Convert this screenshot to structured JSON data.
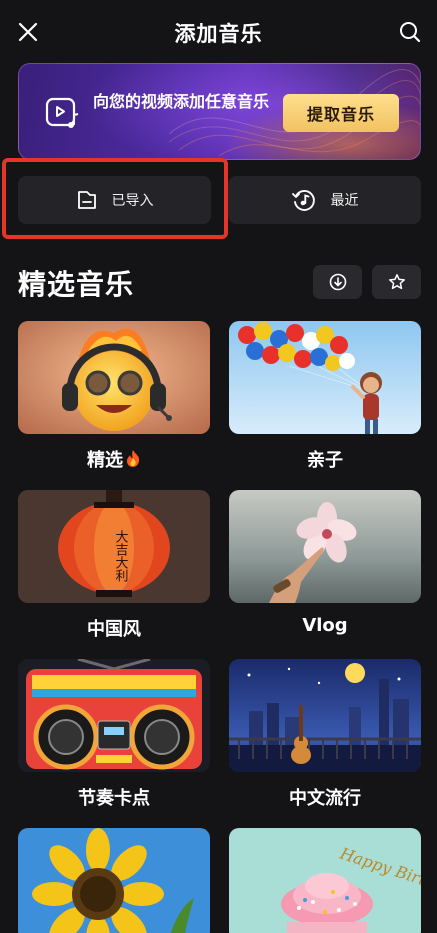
{
  "header": {
    "title": "添加音乐",
    "close_icon": "close-icon",
    "search_icon": "search-icon"
  },
  "banner": {
    "text": "向您的视频添加任意音乐",
    "button_label": "提取音乐",
    "icon": "video-music-icon",
    "button_color": "#f1c261"
  },
  "sources": {
    "imported_label": "已导入",
    "imported_icon": "folder-icon",
    "recent_label": "最近",
    "recent_icon": "recent-music-icon",
    "highlight_color": "#e5352b"
  },
  "featured": {
    "title": "精选音乐",
    "download_icon": "download-icon",
    "favorite_icon": "star-icon"
  },
  "categories": [
    {
      "label": "精选",
      "badge_icon": "fire-icon"
    },
    {
      "label": "亲子"
    },
    {
      "label": "中国风"
    },
    {
      "label": "Vlog"
    },
    {
      "label": "节奏卡点"
    },
    {
      "label": "中文流行"
    },
    {
      "label": ""
    },
    {
      "label": ""
    }
  ],
  "decor": {
    "lantern_text": "大吉大利",
    "cake_text": "Happy Birthday"
  }
}
